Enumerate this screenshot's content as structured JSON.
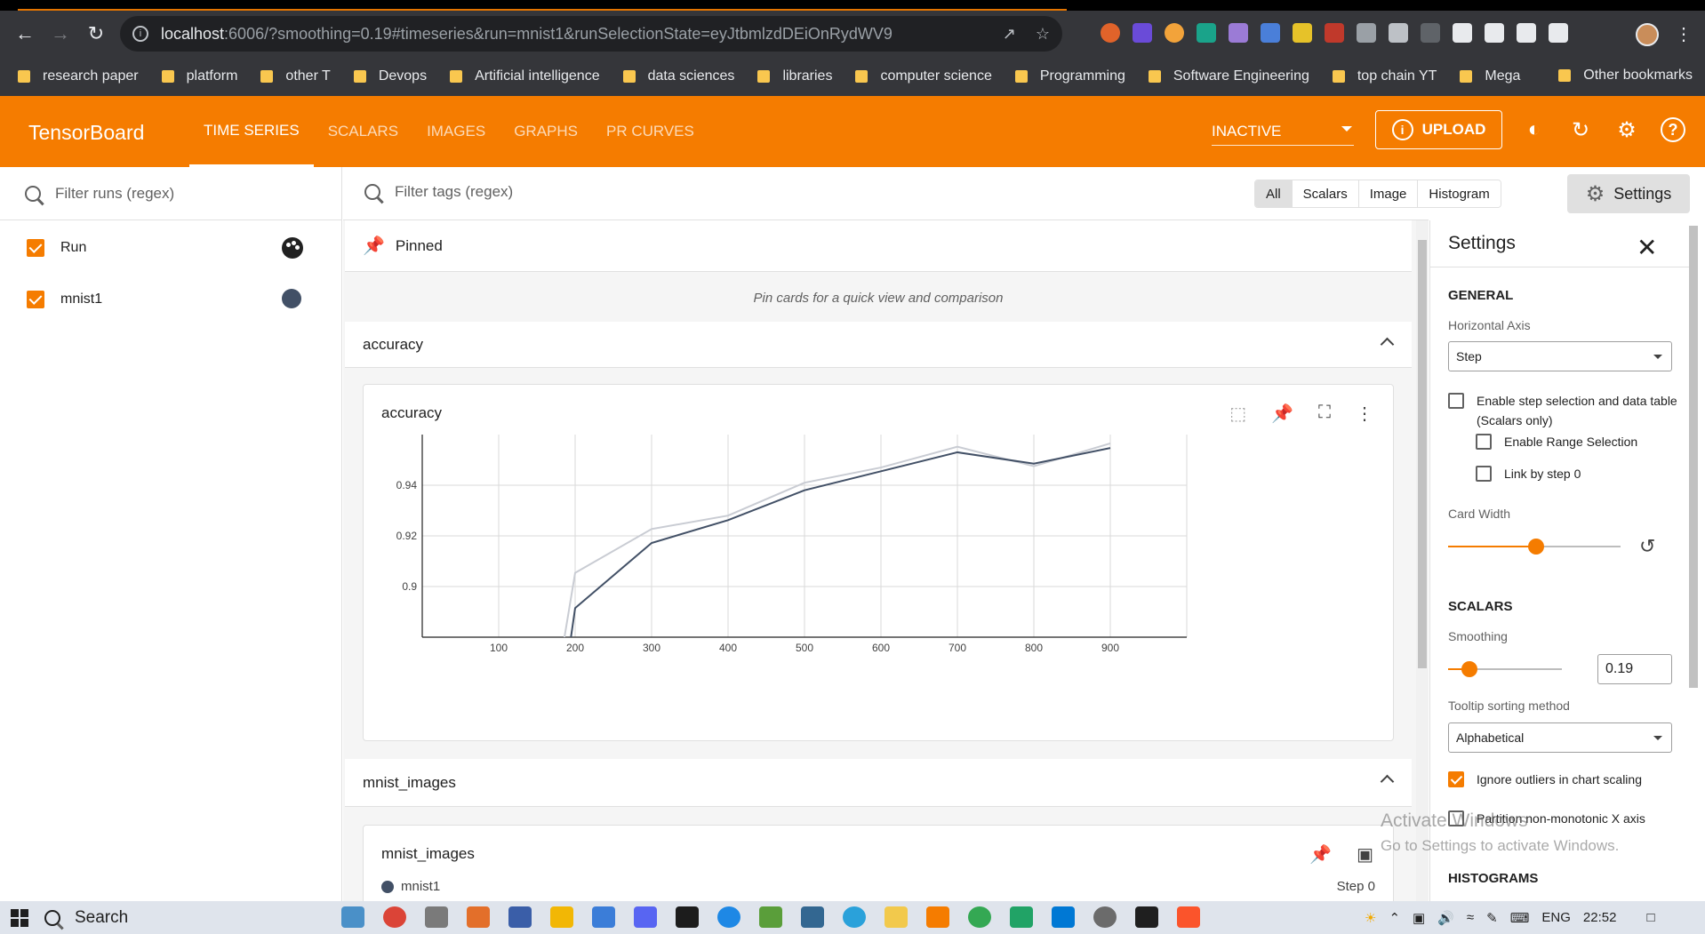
{
  "browser": {
    "url_host": "localhost",
    "url_rest": ":6006/?smoothing=0.19#timeseries&run=mnist1&runSelectionState=eyJtbmlzdDEiOnRydWV9",
    "bookmarks": [
      "research paper",
      "platform",
      "other T",
      "Devops",
      "Artificial intelligence",
      "data sciences",
      "libraries",
      "computer science",
      "Programming",
      "Software Engineering",
      "top chain YT",
      "Mega"
    ],
    "other_bookmarks": "Other bookmarks"
  },
  "header": {
    "logo": "TensorBoard",
    "tabs": [
      "TIME SERIES",
      "SCALARS",
      "IMAGES",
      "GRAPHS",
      "PR CURVES"
    ],
    "active_tab": "TIME SERIES",
    "status": "INACTIVE",
    "upload": "UPLOAD",
    "accent": "#f57c00"
  },
  "sidebar": {
    "filter_placeholder": "Filter runs (regex)",
    "runs": [
      {
        "label": "Run",
        "checked": true,
        "icon": "palette-icon"
      },
      {
        "label": "mnist1",
        "checked": true,
        "color": "#425066"
      }
    ]
  },
  "main": {
    "filter_placeholder": "Filter tags (regex)",
    "type_filters": [
      "All",
      "Scalars",
      "Image",
      "Histogram"
    ],
    "settings_label": "Settings",
    "pinned": {
      "title": "Pinned",
      "hint": "Pin cards for a quick view and comparison"
    },
    "accuracy_group": "accuracy",
    "accuracy_card": "accuracy",
    "images_group": "mnist_images",
    "images_card": "mnist_images",
    "images_run": "mnist1",
    "images_step": "Step 0"
  },
  "chart_data": {
    "type": "line",
    "title": "accuracy",
    "x_ticks": [
      "100",
      "200",
      "300",
      "400",
      "500",
      "600",
      "700",
      "800",
      "900"
    ],
    "y_ticks": [
      "0.9",
      "0.92",
      "0.94"
    ],
    "xlim": [
      0,
      1000
    ],
    "ylim": [
      0.88,
      0.96
    ],
    "grid": true,
    "series": [
      {
        "color": "#c9ccd3",
        "x": [
          175,
          200,
          300,
          400,
          500,
          600,
          700,
          800,
          900
        ],
        "y": [
          0.86,
          0.9054,
          0.9227,
          0.928,
          0.941,
          0.947,
          0.9552,
          0.9475,
          0.9565
        ]
      },
      {
        "color": "#425066",
        "x": [
          185,
          200,
          300,
          400,
          500,
          600,
          700,
          800,
          900
        ],
        "y": [
          0.86,
          0.8915,
          0.9172,
          0.9262,
          0.938,
          0.9455,
          0.953,
          0.9485,
          0.9547
        ]
      }
    ]
  },
  "settings": {
    "title": "Settings",
    "general": "GENERAL",
    "horizontal_axis_label": "Horizontal Axis",
    "horizontal_axis_value": "Step",
    "step_selection": "Enable step selection and data table (Scalars only)",
    "range_selection": "Enable Range Selection",
    "link_by_step": "Link by step 0",
    "card_width_label": "Card Width",
    "card_width_level": 0.51,
    "scalars": "SCALARS",
    "smoothing_label": "Smoothing",
    "smoothing_value": "0.19",
    "tooltip_label": "Tooltip sorting method",
    "tooltip_value": "Alphabetical",
    "ignore_outliers": "Ignore outliers in chart scaling",
    "partition": "Partition non-monotonic X axis",
    "histograms": "HISTOGRAMS"
  },
  "os": {
    "watermark_title": "Activate Windows",
    "watermark_sub": "Go to Settings to activate Windows.",
    "search": "Search",
    "lang": "ENG",
    "time": "22:52"
  }
}
